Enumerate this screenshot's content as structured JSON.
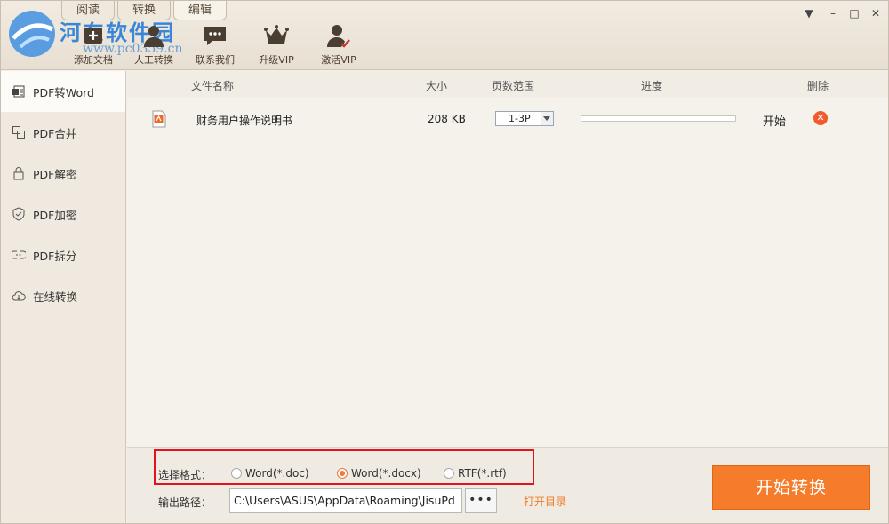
{
  "watermark": {
    "site_name": "河东软件园",
    "url": "www.pc0359.cn"
  },
  "top_tabs": [
    {
      "label": "阅读"
    },
    {
      "label": "转换"
    },
    {
      "label": "编辑"
    }
  ],
  "toolbar": [
    {
      "label": "添加文档",
      "icon": "add-document-icon"
    },
    {
      "label": "人工转换",
      "icon": "person-icon"
    },
    {
      "label": "联系我们",
      "icon": "chat-icon"
    },
    {
      "label": "升级VIP",
      "icon": "crown-icon"
    },
    {
      "label": "激活VIP",
      "icon": "activate-user-icon"
    }
  ],
  "window_controls": {
    "menu": "▼",
    "minimize": "–",
    "maximize": "□",
    "close": "✕"
  },
  "sidebar": {
    "items": [
      {
        "label": "PDF转Word",
        "icon": "word-doc-icon",
        "active": true
      },
      {
        "label": "PDF合并",
        "icon": "merge-icon"
      },
      {
        "label": "PDF解密",
        "icon": "unlock-icon"
      },
      {
        "label": "PDF加密",
        "icon": "shield-icon"
      },
      {
        "label": "PDF拆分",
        "icon": "split-icon"
      },
      {
        "label": "在线转换",
        "icon": "cloud-icon"
      }
    ]
  },
  "table": {
    "headers": {
      "name": "文件名称",
      "size": "大小",
      "pages": "页数范围",
      "progress": "进度",
      "delete": "删除"
    },
    "rows": [
      {
        "name": "财务用户操作说明书",
        "size": "208 KB",
        "pages": "1-3P",
        "progress": 0,
        "action": "开始",
        "icon": "pdf-file-icon"
      }
    ]
  },
  "format": {
    "label": "选择格式：",
    "options": [
      {
        "label": "Word(*.doc)",
        "selected": false
      },
      {
        "label": "Word(*.docx)",
        "selected": true
      },
      {
        "label": "RTF(*.rtf)",
        "selected": false
      }
    ]
  },
  "output": {
    "label": "输出路径：",
    "path": "C:\\Users\\ASUS\\AppData\\Roaming\\JisuPd",
    "browse": "•••",
    "open_dir": "打开目录"
  },
  "convert_button": "开始转换",
  "colors": {
    "accent": "#f57c2b",
    "highlight_box": "#e0141e",
    "watermark": "#2b7fd8",
    "delete": "#ef5a2e"
  }
}
